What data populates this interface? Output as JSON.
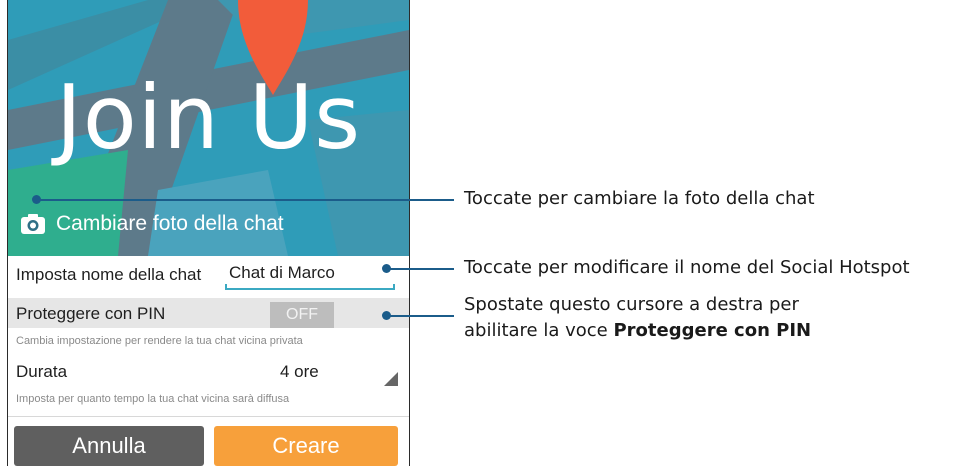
{
  "hero": {
    "title": "Join Us",
    "change_photo_label": "Cambiare foto della chat"
  },
  "form": {
    "name_label": "Imposta nome della chat",
    "name_value": "Chat di Marco",
    "pin_label": "Proteggere con PIN",
    "pin_toggle": "OFF",
    "pin_hint": "Cambia impostazione per rendere la tua chat vicina privata",
    "duration_label": "Durata",
    "duration_value": "4 ore",
    "duration_hint": "Imposta per quanto tempo la tua chat vicina sarà diffusa"
  },
  "buttons": {
    "cancel": "Annulla",
    "create": "Creare"
  },
  "callouts": {
    "photo": "Toccate per cambiare la foto della chat",
    "name": "Toccate per modificare il nome del Social Hotspot",
    "pin_line1": "Spostate questo cursore a destra per",
    "pin_line2_prefix": "abilitare la voce ",
    "pin_line2_bold": "Proteggere con PIN"
  },
  "colors": {
    "accent": "#3ba9c2",
    "create": "#f7a03b",
    "cancel": "#5f5f5f",
    "callout": "#1b5c8a"
  }
}
